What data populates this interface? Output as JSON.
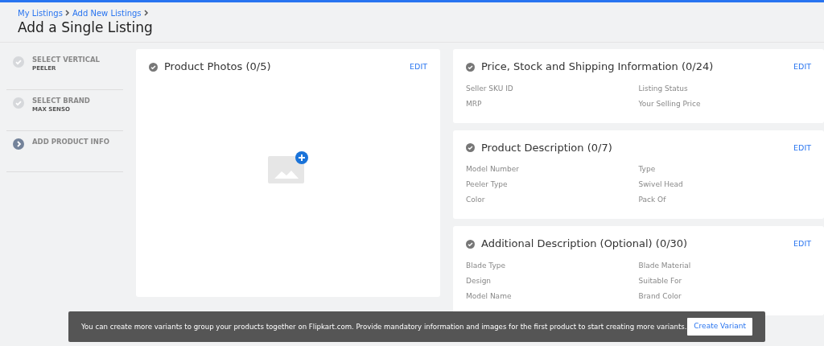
{
  "breadcrumb": [
    "My Listings",
    "Add New Listings"
  ],
  "page_title": "Add a Single Listing",
  "steps": [
    {
      "title": "SELECT VERTICAL",
      "value": "PEELER",
      "done": true
    },
    {
      "title": "SELECT BRAND",
      "value": "MAX SENSO",
      "done": true
    },
    {
      "title": "ADD PRODUCT INFO",
      "done": false
    }
  ],
  "photos_card": {
    "title": "Product Photos (0/5)",
    "edit": "EDIT"
  },
  "sections": [
    {
      "title": "Price, Stock and Shipping Information (0/24)",
      "edit": "EDIT",
      "fields": [
        "Seller SKU ID",
        "Listing Status",
        "MRP",
        "Your Selling Price"
      ]
    },
    {
      "title": "Product Description (0/7)",
      "edit": "EDIT",
      "fields": [
        "Model Number",
        "Type",
        "Peeler Type",
        "Swivel Head",
        "Color",
        "Pack Of"
      ]
    },
    {
      "title": "Additional Description (Optional) (0/30)",
      "edit": "EDIT",
      "fields": [
        "Blade Type",
        "Blade Material",
        "Design",
        "Suitable For",
        "Model Name",
        "Brand Color"
      ]
    }
  ],
  "toast": {
    "message": "You can create more variants to group your products together on Flipkart.com. Provide mandatory information and images for the first product to start creating more variants.",
    "button": "Create Variant"
  }
}
